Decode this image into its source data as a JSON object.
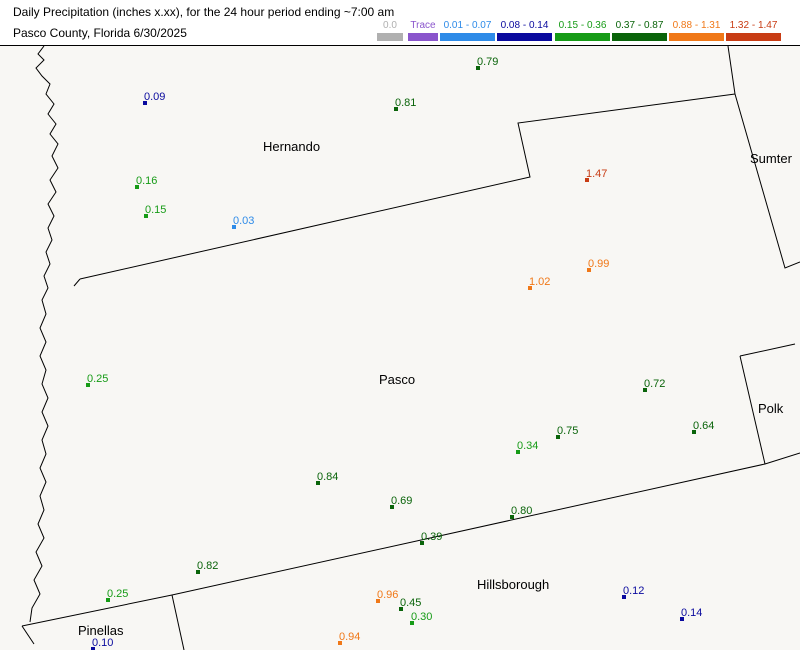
{
  "header": {
    "title": "Daily Precipitation (inches  x.xx),  for the 24 hour period ending ~7:00 am",
    "subtitle": "Pasco County, Florida  6/30/2025"
  },
  "legend": [
    {
      "label": "0.0",
      "color": "#b0b0b0"
    },
    {
      "label": "Trace",
      "color": "#8a55cc"
    },
    {
      "label": "0.01 - 0.07",
      "color": "#2e8be8"
    },
    {
      "label": "0.08 - 0.14",
      "color": "#0a0a9e"
    },
    {
      "label": "0.15 - 0.36",
      "color": "#169b16"
    },
    {
      "label": "0.37 - 0.87",
      "color": "#0a640a"
    },
    {
      "label": "0.88 - 1.31",
      "color": "#f07818"
    },
    {
      "label": "1.32 - 1.47",
      "color": "#c83c14"
    }
  ],
  "counties": [
    {
      "name": "Hernando"
    },
    {
      "name": "Sumter"
    },
    {
      "name": "Pasco"
    },
    {
      "name": "Polk"
    },
    {
      "name": "Hillsborough"
    },
    {
      "name": "Pinellas"
    }
  ],
  "observations": [
    {
      "value": "0.79",
      "category": 5
    },
    {
      "value": "0.09",
      "category": 3
    },
    {
      "value": "0.81",
      "category": 5
    },
    {
      "value": "0.16",
      "category": 4
    },
    {
      "value": "0.15",
      "category": 4
    },
    {
      "value": "0.03",
      "category": 2
    },
    {
      "value": "1.47",
      "category": 7
    },
    {
      "value": "0.99",
      "category": 6
    },
    {
      "value": "1.02",
      "category": 6
    },
    {
      "value": "0.25",
      "category": 4
    },
    {
      "value": "0.72",
      "category": 5
    },
    {
      "value": "0.64",
      "category": 5
    },
    {
      "value": "0.75",
      "category": 5
    },
    {
      "value": "0.34",
      "category": 4
    },
    {
      "value": "0.84",
      "category": 5
    },
    {
      "value": "0.69",
      "category": 5
    },
    {
      "value": "0.80",
      "category": 5
    },
    {
      "value": "0.39",
      "category": 5
    },
    {
      "value": "0.82",
      "category": 5
    },
    {
      "value": "0.25",
      "category": 4
    },
    {
      "value": "0.96",
      "category": 6
    },
    {
      "value": "0.45",
      "category": 5
    },
    {
      "value": "0.30",
      "category": 4
    },
    {
      "value": "0.12",
      "category": 3
    },
    {
      "value": "0.14",
      "category": 3
    },
    {
      "value": "0.94",
      "category": 6
    },
    {
      "value": "0.10",
      "category": 3
    }
  ]
}
